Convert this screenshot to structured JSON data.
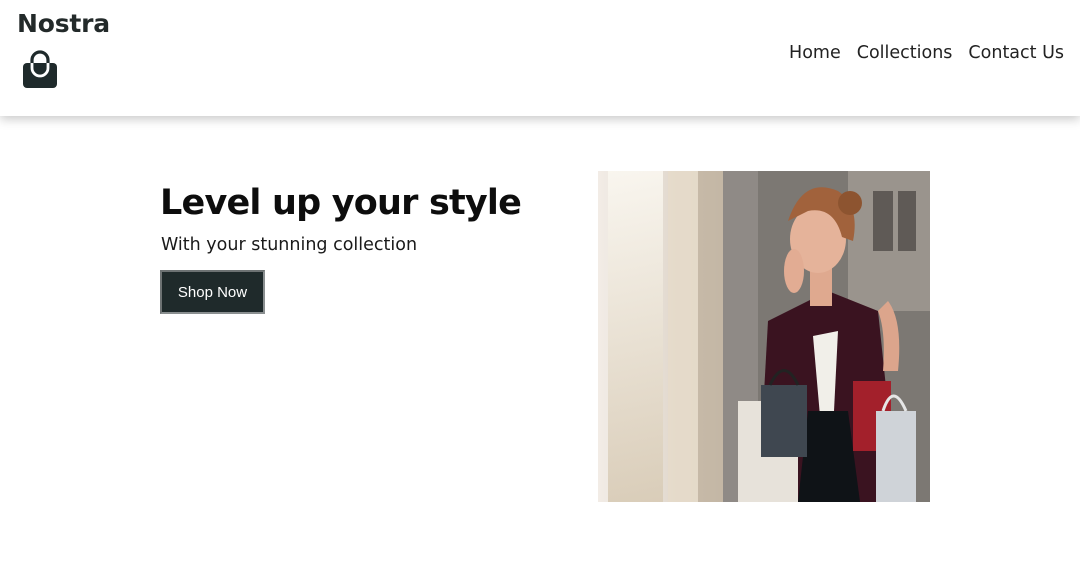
{
  "brand": {
    "name": "Nostra",
    "icon": "shopping-bag-icon"
  },
  "nav": {
    "links": [
      "Home",
      "Collections",
      "Contact Us"
    ]
  },
  "hero": {
    "title": "Level up your style",
    "subtitle": "With your stunning collection",
    "cta_label": "Shop Now",
    "image": "woman-shopping-photo"
  },
  "colors": {
    "brand_dark": "#232a2a",
    "button_bg": "#1f2a2b",
    "navbar_bg": "#ffffff"
  }
}
